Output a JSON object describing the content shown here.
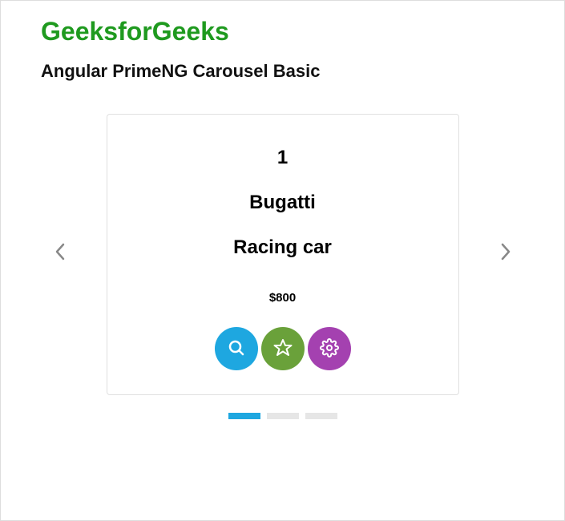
{
  "brand": "GeeksforGeeks",
  "subtitle": "Angular PrimeNG Carousel Basic",
  "carousel": {
    "activeIndex": 0,
    "totalPages": 3,
    "item": {
      "id": "1",
      "name": "Bugatti",
      "type": "Racing car",
      "price": "$800"
    }
  },
  "colors": {
    "brand": "#1f9a1f",
    "primary": "#1ea7e0",
    "success": "#6aa13a",
    "help": "#a441b0"
  }
}
